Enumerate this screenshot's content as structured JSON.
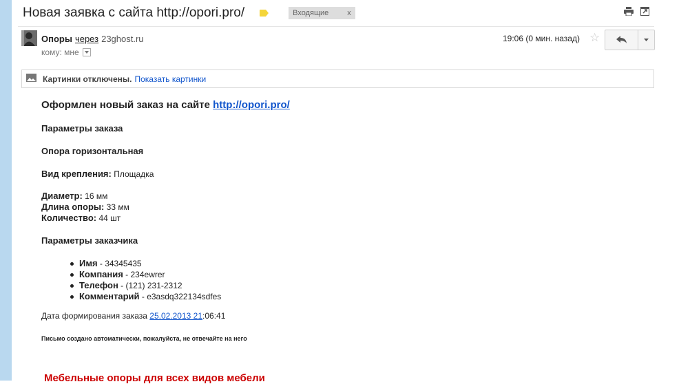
{
  "subject": "Новая заявка с сайта http://opori.pro/",
  "inbox_label": "Входящие",
  "inbox_remove": "x",
  "sender": {
    "name": "Опоры",
    "via": "через",
    "domain": "23ghost.ru",
    "to_label": "кому: мне",
    "time": "19:06 (0 мин. назад)"
  },
  "images_bar": {
    "off_text": "Картинки отключены.",
    "show_link": "Показать картинки"
  },
  "message": {
    "heading_prefix": "Оформлен новый заказ на сайте",
    "heading_link": "http://opori.pro/",
    "order_params_title": "Параметры заказа",
    "product": "Опора горизонтальная",
    "mount_label": "Вид крепления:",
    "mount_value": "Площадка",
    "diameter_label": "Диаметр:",
    "diameter_value": "16 мм",
    "length_label": "Длина опоры:",
    "length_value": "33 мм",
    "qty_label": "Количество:",
    "qty_value": "44 шт",
    "customer_title": "Параметры заказчика",
    "customer": [
      {
        "label": "Имя",
        "value": " - 34345435"
      },
      {
        "label": "Компания",
        "value": " - 234ewrer"
      },
      {
        "label": "Телефон",
        "value": " - (121) 231-2312"
      },
      {
        "label": "Комментарий",
        "value": " - e3asdq322134sdfes"
      }
    ],
    "date_label": "Дата формирования заказа",
    "date_link": "25.02.2013 21",
    "date_rest": ":06:41",
    "auto_note": "Письмо создано автоматически, пожалуйста, не отвечайте на него",
    "footer_red": "Мебельные опоры для всех видов мебели"
  }
}
